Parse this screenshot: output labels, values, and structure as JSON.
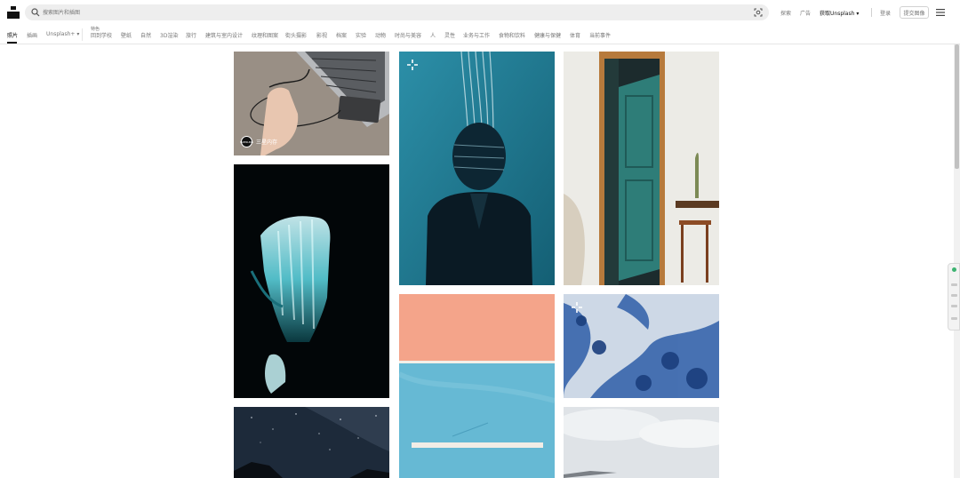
{
  "search": {
    "placeholder": "搜索图片和插图"
  },
  "header": {
    "explore": "探索",
    "advertise": "广告",
    "get_unsplash": "获取Unsplash",
    "login": "登录",
    "submit": "提交图像"
  },
  "tabs": {
    "photos": "照片",
    "illustrations": "插画",
    "unsplash_plus": "Unsplash+",
    "featured_label": "特色",
    "items": [
      "回到学校",
      "壁纸",
      "自然",
      "3D渲染",
      "旅行",
      "建筑与室内设计",
      "纹理和图案",
      "街头摄影",
      "影视",
      "档案",
      "实验",
      "动物",
      "时尚与美容",
      "人",
      "灵性",
      "业务与工作",
      "食物和饮料",
      "健康与保健",
      "体育",
      "当前事件"
    ]
  },
  "photos": {
    "samsung_caption": "三星内存",
    "samsung_avatar": "SAMSUNG"
  },
  "colors": {
    "brand": "#111111",
    "muted_text": "#767676",
    "search_bg": "#eeeeee",
    "status_green": "#3cb371"
  }
}
